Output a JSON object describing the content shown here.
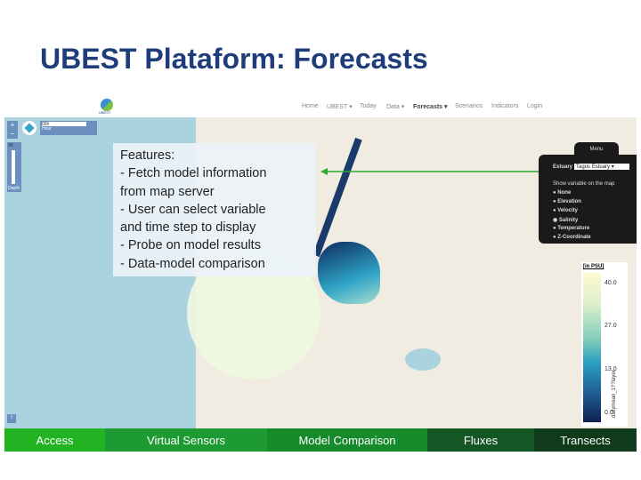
{
  "title": "UBEST Plataform: Forecasts",
  "nav": {
    "logo": "UBEST",
    "items": [
      "Home",
      "UBEST ▾",
      "Today",
      "Data ▾",
      "Forecasts ▾",
      "Scenarios",
      "Indicators",
      "Login"
    ],
    "active": "Forecasts ▾"
  },
  "map_controls": {
    "zoom_in": "+",
    "zoom_out": "−",
    "time_value": "00h",
    "time_label": "Hour",
    "depth_value": "39",
    "depth_label": "Depth",
    "info": "i"
  },
  "features": {
    "lines": [
      "Features:",
      "- Fetch model information",
      "from map server",
      "- User can select variable",
      "and time step to display",
      "- Probe on model results",
      "- Data-model comparison"
    ]
  },
  "menu": {
    "tab": "Menu",
    "estuary_label": "Estuary",
    "estuary_value": "Tagus Estuary ▾",
    "show_label": "Show variable on the map",
    "options": [
      "None",
      "Elevation",
      "Velocity",
      "Salinity",
      "Temperature",
      "Z-Coordinate"
    ],
    "selected": "Salinity"
  },
  "legend": {
    "unit": "[in PSU]",
    "ticks": [
      "40.0",
      "27.0",
      "13.0",
      "0.0"
    ],
    "layer": "dailymean_1??layer"
  },
  "bottom_tabs": [
    {
      "label": "Access",
      "color": "#22b322"
    },
    {
      "label": "Virtual Sensors",
      "color": "#1d9a31"
    },
    {
      "label": "Model Comparison",
      "color": "#178a2c"
    },
    {
      "label": "Fluxes",
      "color": "#145624"
    },
    {
      "label": "Transects",
      "color": "#0f3b1b"
    }
  ],
  "colors": {
    "title": "#1f3d7a",
    "arrow": "#2ea82e"
  }
}
